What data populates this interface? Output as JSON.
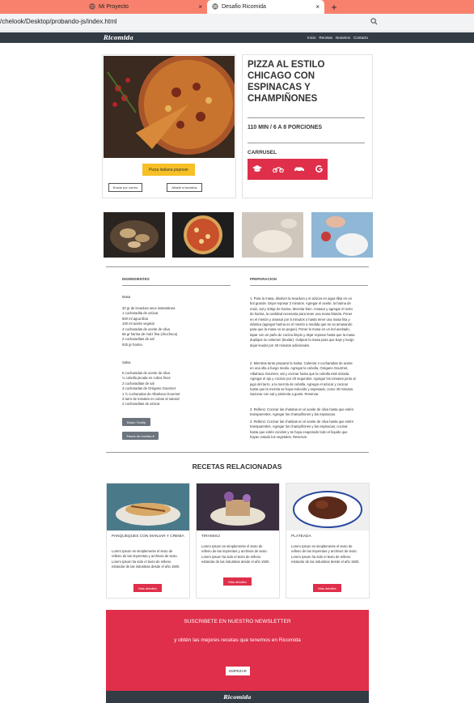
{
  "browser": {
    "tabs": [
      {
        "label": "Mi Proyecto"
      },
      {
        "label": "Desafio Ricomida"
      }
    ],
    "new_tab": "+",
    "close_glyph": "×",
    "url": "/chelook/Desktop/probando-js/index.html",
    "colors": {
      "tabbar": "#f7816d"
    }
  },
  "site": {
    "brand": "Ricomida",
    "nav": [
      "Inicio",
      "Recetas",
      "Nosotros",
      "Contacto"
    ]
  },
  "hero": {
    "title": "PIZZA AL ESTILO CHICAGO CON ESPINACAS Y CHAMPIÑONES",
    "time": "110 MIN / 6 A 8 PORCIONES",
    "carrusel": "CARRUSEL",
    "popover_button": "Pizza italiana popover",
    "email_button": "Enviar por correo",
    "fav_button": "Añadir a favoritos",
    "carrusel_icons": [
      "graduation-cap-icon",
      "motorcycle-icon",
      "car-icon",
      "google-icon"
    ],
    "accent": "#df2f4a",
    "popover_color": "#f6c026"
  },
  "recipe": {
    "ingredients_heading": "INGREDIENTES",
    "prep_heading": "PREPARACION",
    "masa_label": "Masa",
    "masa_items": [
      "20 gr de levadura seca instantánea",
      "1 cucharadita de azúcar",
      "500 ml agua tibia",
      "100 ml aceite vegetal",
      "4 cucharadas de aceite de oliva",
      "65 gr harina de maíz fina (chuchoca)",
      "2 cucharaditas de sal",
      "625 gr harina"
    ],
    "salsa_label": "Salsa",
    "salsa_items": [
      "5 cucharadas de aceite de oliva",
      "¼ cebolla picada en cubos finos",
      "2 cucharaditas de sal",
      "3 cucharadas de Orégano Gourmet",
      "1 ½ cucharadas de Albahaca Gourmet",
      "3 tarro de tomates en cubos al natural",
      "2 cucharaditas de azúcar"
    ],
    "tooltip_button": "Boton Tooltip",
    "dropdown_button": "Pasos de recetas ▾",
    "steps": [
      "1. Para la masa, disolver la levadura y el azúcar en agua tibia en un bol grande. Dejar reposar 2 minutos. Agregar el aceite, la harina de maíz, sal y 400gr de harina. Mezclar bien. Amasar y agregar el resto de harina, la cantidad necesaria para tener una masa blanda. Poner en el mesón y amasar por 5 minutos o hasta tener una masa lisa y elástica (agregar harina en el mesón a medida que se va amasando para que la masa no se pegue). Poner la masa en un bol aceitado, tapar con un paño de cocina limpio y dejar reposar hasta que la masa duplique su volumen (leudar). Golpear la masa para que baje y luego dejar leudar por 40 minutos adicionales.",
      "2. Mientras tanto preparar la Salsa: Calentar 4 cucharadas de aceite en una olla a fuego medio. Agregar la cebolla, Orégano Gourmet, Albahaca Gourmet, sal y cocinar hasta que la cebolla esté dorada. Agregar el ajo y cocinar por 20 segundos. Agregar los tomates junto al jugo del tarro, a la mezcla de cebolla. Agregar el azúcar y cocinar hasta que la mezcla se haya reducido y espesado, como 30 minutos. Sazonar con sal y pimienta a gusto. Reservar.",
      "3. Relleno: Cocinar las chalotas en el aceite de oliva hasta que estén transparentes. Agregar los champiñones y las espinacas.",
      "3. Relleno: Cocinar las chalotas en el aceite de oliva hasta que estén transparentes. Agregar los champiñones y las espinacas; cocinar hasta que estén cocidos y se haya evaporado todo el líquido que hayan votado los vegetales. Reservar."
    ]
  },
  "related": {
    "heading": "RECETAS RELACIONADAS",
    "body": "Lorem Ipsum es simplemente el texto de relleno de las imprentas y archivos de texto. Lorem Ipsum ha sido el texto de relleno estándar de las industrias desde el año 1500.",
    "button": "Más detalles",
    "cards": [
      {
        "title": "PANQUEQUES CON MANJAR Y CREMA"
      },
      {
        "title": "TIRAMISÚ"
      },
      {
        "title": "PLATEADA"
      }
    ]
  },
  "newsletter": {
    "title": "SUSCRIBETE EN NUESTRO NEWSLETTER",
    "subtitle": "y obtén las mejores recetas que tenemos en Ricomida",
    "button": "EMPEZAR"
  },
  "footer": {
    "brand": "Ricomida"
  }
}
